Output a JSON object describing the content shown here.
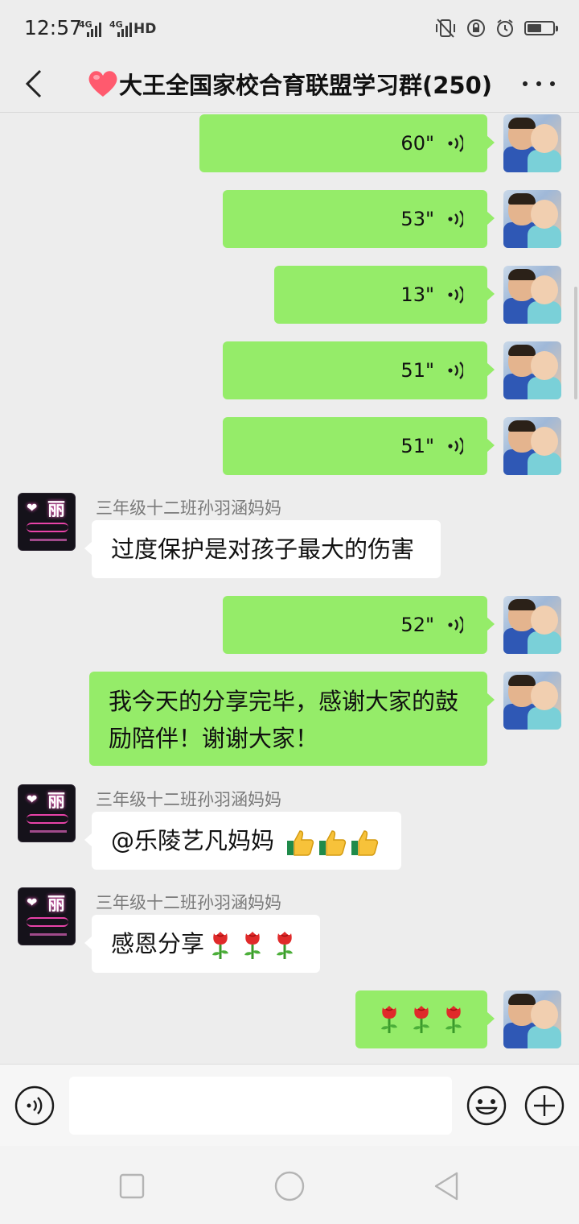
{
  "status": {
    "time": "12:57",
    "net1": "4G",
    "net2": "4G",
    "hd": "HD",
    "battery_level": 0.55
  },
  "header": {
    "title": "大王全国家校合育联盟学习群(250)",
    "heart_color": "#ff5a6e"
  },
  "colors": {
    "bubble_me": "#95ec69",
    "bubble_other": "#ffffff",
    "background": "#ededed"
  },
  "messages": [
    {
      "type": "voice",
      "from": "me",
      "duration": "60\""
    },
    {
      "type": "voice",
      "from": "me",
      "duration": "53\""
    },
    {
      "type": "voice",
      "from": "me",
      "duration": "13\""
    },
    {
      "type": "voice",
      "from": "me",
      "duration": "51\""
    },
    {
      "type": "voice",
      "from": "me",
      "duration": "51\""
    },
    {
      "type": "text",
      "from": "other",
      "sender": "三年级十二班孙羽涵妈妈",
      "text": "过度保护是对孩子最大的伤害"
    },
    {
      "type": "voice",
      "from": "me",
      "duration": "52\""
    },
    {
      "type": "text",
      "from": "me",
      "line1": "我今天的分享完毕，感谢大家的鼓",
      "line2": "励陪伴！谢谢大家！"
    },
    {
      "type": "text",
      "from": "other",
      "sender": "三年级十二班孙羽涵妈妈",
      "text": "@乐陵艺凡妈妈",
      "emoji": "thumbs-up x3"
    },
    {
      "type": "text",
      "from": "other",
      "sender": "三年级十二班孙羽涵妈妈",
      "text": "感恩分享",
      "emoji": "rose x3"
    },
    {
      "type": "emoji",
      "from": "me",
      "emoji": "rose x3"
    }
  ],
  "avatar_other": {
    "heart": "❤",
    "char": "丽"
  },
  "input": {
    "placeholder": ""
  },
  "icons": [
    "back-arrow-icon",
    "more-icon",
    "voice-wave-icon",
    "voice-input-icon",
    "emoji-icon",
    "plus-icon",
    "nav-square-icon",
    "nav-circle-icon",
    "nav-triangle-icon"
  ]
}
